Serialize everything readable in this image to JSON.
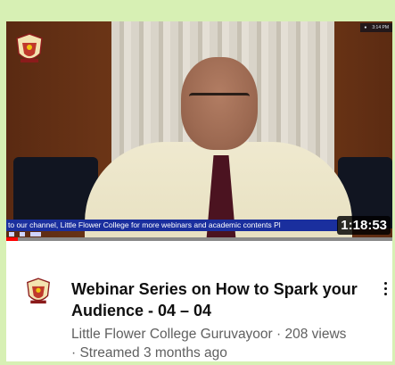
{
  "video": {
    "ticker_text": "to our channel, Little Flower College for more webinars and academic contents Pl",
    "duration": "1:18:53",
    "progress_fraction": 0.03,
    "tray_time": "3:14 PM"
  },
  "meta": {
    "title": "Webinar Series on How to Spark your Audience - 04 – 04",
    "channel_views": "Little Flower College Guruvayoor · 208 views",
    "streamed": "· Streamed 3 months ago"
  },
  "colors": {
    "ticker_bg": "#1a2f9e",
    "progress": "#ff0000",
    "background": "#d7f0b4"
  },
  "icons": {
    "logo": "college-crest-icon",
    "more": "kebab-menu-icon"
  }
}
